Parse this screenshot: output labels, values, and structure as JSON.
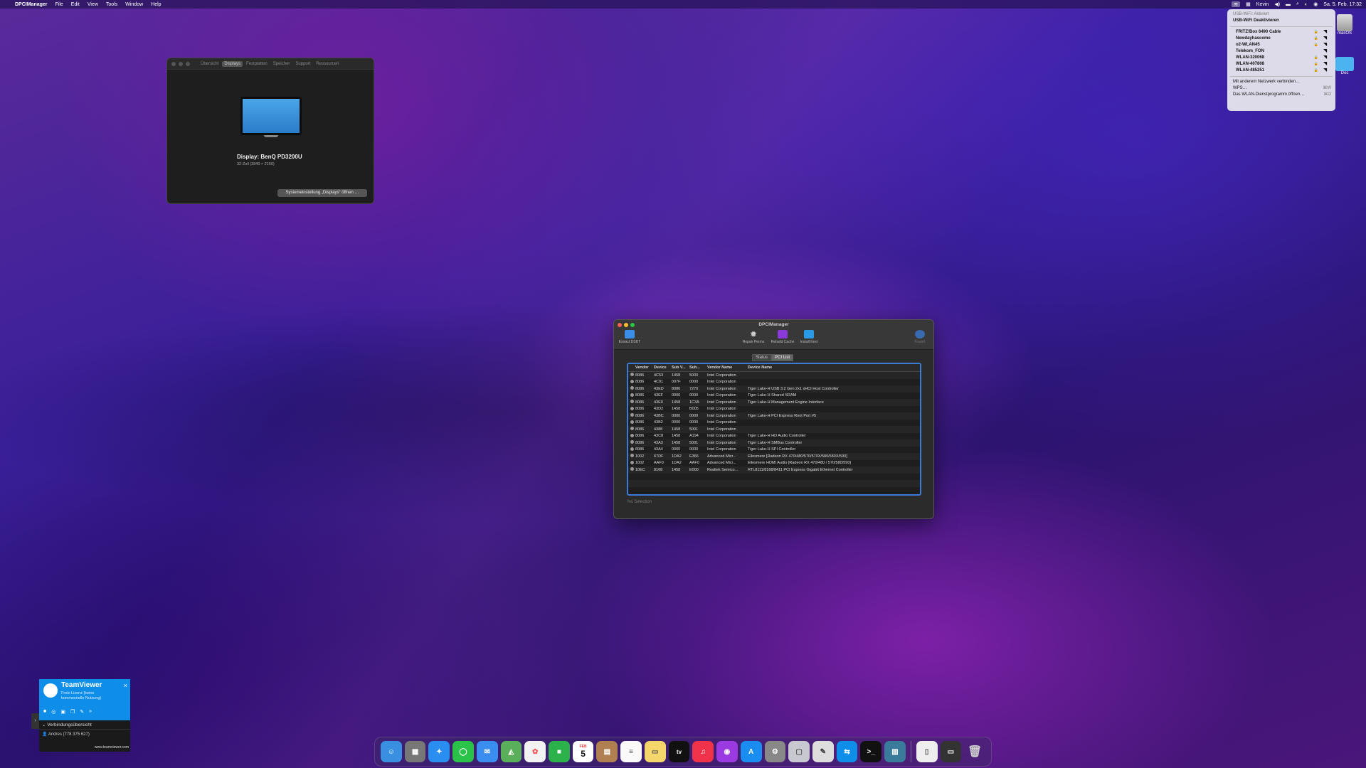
{
  "menubar": {
    "apple": "",
    "app": "DPCIManager",
    "items": [
      "File",
      "Edit",
      "View",
      "Tools",
      "Window",
      "Help"
    ],
    "user": "Kevin",
    "clock": "Sa. 5. Feb. 17:32"
  },
  "wifi_menu": {
    "status": "USB-WiFi: Aktiviert",
    "toggle": "USB-WiFi Deaktivieren",
    "networks": [
      {
        "name": "FRITZ!Box 6490 Cable",
        "locked": true
      },
      {
        "name": "Newdayhascome",
        "locked": true
      },
      {
        "name": "o2-WLAN45",
        "locked": true
      },
      {
        "name": "Telekom_FON",
        "locked": false
      },
      {
        "name": "WLAN-320068",
        "locked": true
      },
      {
        "name": "WLAN-407808",
        "locked": true
      },
      {
        "name": "WLAN-485251",
        "locked": true
      }
    ],
    "other": "Mit anderem Netzwerk verbinden…",
    "wps": "WPS…",
    "utility": "Das WLAN-Dienstprogramm öffnen…",
    "shortcut1": "⌘W",
    "shortcut2": "⌘O",
    "lock_glyph": "🔒",
    "signal_glyph": "◥"
  },
  "desktop": {
    "hd_label": "macOS",
    "folder_label": "Doc"
  },
  "sysinfo": {
    "tabs": [
      "Übersicht",
      "Displays",
      "Festplatten",
      "Speicher",
      "Support",
      "Ressourcen"
    ],
    "display_name": "Display: BenQ PD3200U",
    "display_sub": "32-Zoll (3840 × 2160)",
    "button": "Systemeinstellung „Displays“ öffnen …"
  },
  "dpci": {
    "title": "DPCIManager",
    "tools": {
      "extract": "Extract DSDT",
      "repair": "Repair Perms",
      "rebuild": "Rebuild Cache",
      "install": "Install Kext",
      "found": "Found"
    },
    "tab_status": "Status",
    "tab_pci": "PCI List",
    "headers": [
      "Vendor",
      "Device",
      "Sub V...",
      "Sub...",
      "Vendor Name",
      "Device Name"
    ],
    "rows": [
      [
        "8086",
        "4C53",
        "1458",
        "5000",
        "Intel Corporation",
        ""
      ],
      [
        "8086",
        "4C01",
        "007F",
        "0000",
        "Intel Corporation",
        ""
      ],
      [
        "8086",
        "43ED",
        "8086",
        "7270",
        "Intel Corporation",
        "Tiger Lake-H USB 3.2 Gen 2x1 xHCI Host Controller"
      ],
      [
        "8086",
        "43EF",
        "0000",
        "0000",
        "Intel Corporation",
        "Tiger Lake-H Shared SRAM"
      ],
      [
        "8086",
        "43E0",
        "1458",
        "1C3A",
        "Intel Corporation",
        "Tiger Lake-H Management Engine Interface"
      ],
      [
        "8086",
        "43D2",
        "1458",
        "B005",
        "Intel Corporation",
        ""
      ],
      [
        "8086",
        "43BC",
        "0000",
        "0000",
        "Intel Corporation",
        "Tiger Lake-H PCI Express Root Port #5"
      ],
      [
        "8086",
        "43B2",
        "0000",
        "0000",
        "Intel Corporation",
        ""
      ],
      [
        "8086",
        "4388",
        "1458",
        "5001",
        "Intel Corporation",
        ""
      ],
      [
        "8086",
        "43C8",
        "1458",
        "A194",
        "Intel Corporation",
        "Tiger Lake-H HD Audio Controller"
      ],
      [
        "8086",
        "43A3",
        "1458",
        "5001",
        "Intel Corporation",
        "Tiger Lake-H SMBus Controller"
      ],
      [
        "8086",
        "43A4",
        "0000",
        "0000",
        "Intel Corporation",
        "Tiger Lake-H SPI Controller"
      ],
      [
        "1002",
        "67DF",
        "1DA2",
        "E366",
        "Advanced Micr...",
        "Ellesmere [Radeon RX 470/480/570/570X/580/580X/590]"
      ],
      [
        "1002",
        "AAF0",
        "1DA2",
        "AAF0",
        "Advanced Micr...",
        "Ellesmere HDMI Audio [Radeon RX 470/480 / 570/580/590]"
      ],
      [
        "10EC",
        "8168",
        "1458",
        "E000",
        "Realtek Semico...",
        "RTL8111/8168/8411 PCI Express Gigabit Ethernet Controller"
      ]
    ],
    "no_selection": "No Selection"
  },
  "teamviewer": {
    "name": "TeamViewer",
    "license": "Freie Lizenz (keine kommerzielle Nutzung)",
    "section": "Verbindungsübersicht",
    "user": "Andres (778 375 627)",
    "url": "www.teamviewer.com",
    "close": "×"
  },
  "dock": {
    "calendar_month": "FEB",
    "calendar_day": "5",
    "tv_label": "tv"
  },
  "colors": {
    "accent": "#3a7bd5",
    "teamviewer": "#0e8ee9"
  }
}
